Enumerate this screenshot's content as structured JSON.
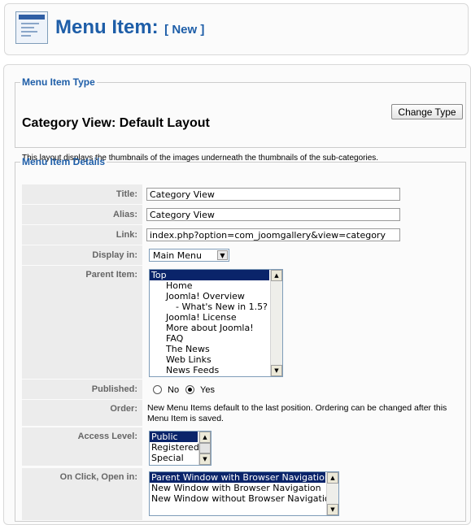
{
  "header": {
    "title": "Menu Item:",
    "subtitle": "[ New ]",
    "icon": "menu-item-icon"
  },
  "type_section": {
    "legend": "Menu Item Type",
    "heading": "Category View: Default Layout",
    "change_type_label": "Change Type",
    "description": "This layout displays the thumbnails of the images underneath the thumbnails of the sub-categories."
  },
  "details": {
    "legend": "Menu Item Details",
    "title_label": "Title:",
    "title_value": "Category View",
    "alias_label": "Alias:",
    "alias_value": "Category View",
    "link_label": "Link:",
    "link_value": "index.php?option=com_joomgallery&view=category",
    "display_label": "Display in:",
    "display_value": "Main Menu",
    "parent_label": "Parent Item:",
    "parent_items": [
      {
        "label": "Top",
        "selected": true
      },
      {
        "label": "Home"
      },
      {
        "label": "Joomla! Overview"
      },
      {
        "label": "- What's New in 1.5?"
      },
      {
        "label": "Joomla! License"
      },
      {
        "label": "More about Joomla!"
      },
      {
        "label": "FAQ"
      },
      {
        "label": "The News"
      },
      {
        "label": "Web Links"
      },
      {
        "label": "News Feeds"
      }
    ],
    "published_label": "Published:",
    "published_no": "No",
    "published_yes": "Yes",
    "published_value": "Yes",
    "order_label": "Order:",
    "order_text_line1": "New Menu Items default to the last position. Ordering can be changed after this",
    "order_text_line2": "Menu Item is saved.",
    "access_label": "Access Level:",
    "access_items": [
      {
        "label": "Public",
        "selected": true
      },
      {
        "label": "Registered"
      },
      {
        "label": "Special"
      }
    ],
    "onclick_label": "On Click, Open in:",
    "onclick_items": [
      {
        "label": "Parent Window with Browser Navigation",
        "selected": true
      },
      {
        "label": "New Window with Browser Navigation"
      },
      {
        "label": "New Window without Browser Navigation"
      }
    ]
  },
  "colors": {
    "accent": "#1e5ea8",
    "selection": "#0a246a",
    "label_bg": "#ececec"
  }
}
